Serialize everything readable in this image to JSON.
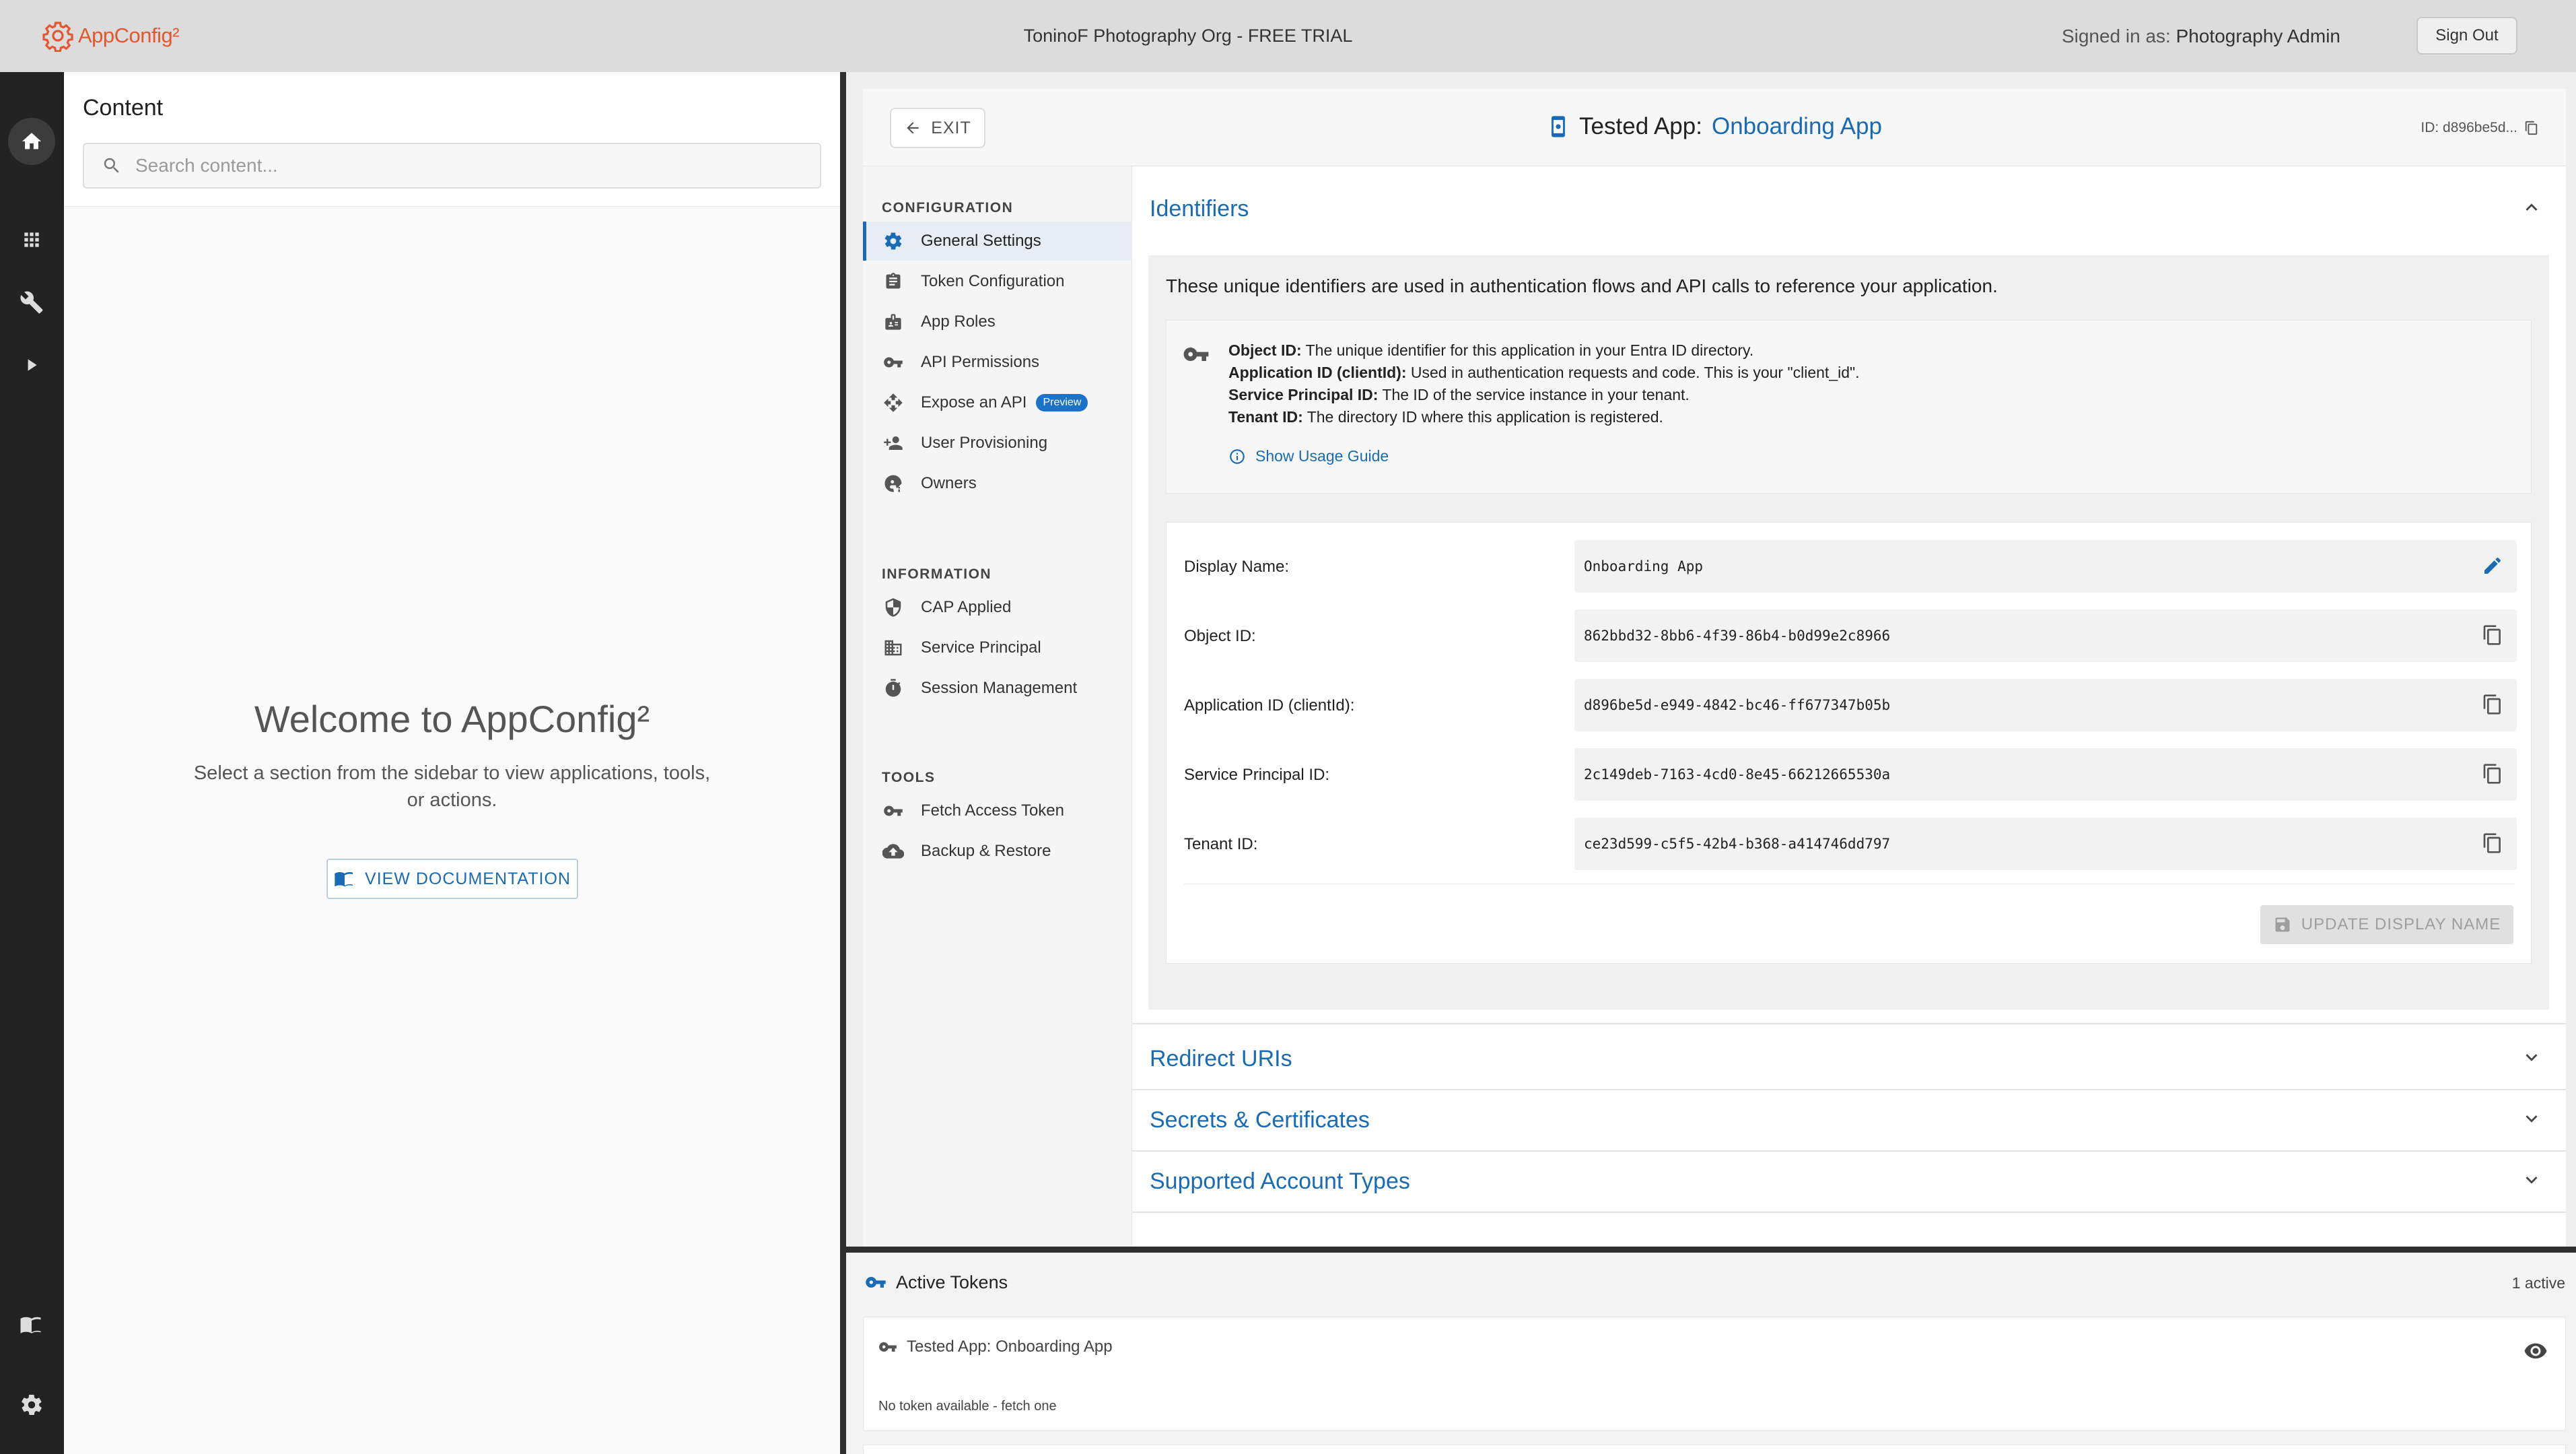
{
  "topbar": {
    "logo_text": "AppConfig²",
    "org_title": "ToninoF Photography Org - FREE TRIAL",
    "signed_in_prefix": "Signed in as:",
    "signed_in_user": "Photography Admin",
    "sign_out_label": "Sign Out"
  },
  "rail": {
    "items": [
      "home-icon",
      "apps-grid-icon",
      "wrench-icon",
      "play-icon",
      "book-icon",
      "gear-icon"
    ]
  },
  "content": {
    "title": "Content",
    "search_placeholder": "Search content...",
    "welcome_title": "Welcome to AppConfig²",
    "welcome_text": "Select a section from the sidebar to view applications, tools, or actions.",
    "doc_button": "VIEW DOCUMENTATION"
  },
  "app": {
    "exit_label": "EXIT",
    "title_prefix": "Tested App:",
    "title_name": "Onboarding App",
    "id_label": "ID: d896be5d..."
  },
  "nav": {
    "sections": [
      {
        "title": "CONFIGURATION",
        "items": [
          {
            "label": "General Settings",
            "icon": "gear-icon",
            "active": true
          },
          {
            "label": "Token Configuration",
            "icon": "clipboard-icon"
          },
          {
            "label": "App Roles",
            "icon": "badge-icon"
          },
          {
            "label": "API Permissions",
            "icon": "key-icon"
          },
          {
            "label": "Expose an API",
            "icon": "move-icon",
            "badge": "Preview"
          },
          {
            "label": "User Provisioning",
            "icon": "person-add-icon"
          },
          {
            "label": "Owners",
            "icon": "owner-icon"
          }
        ]
      },
      {
        "title": "INFORMATION",
        "items": [
          {
            "label": "CAP Applied",
            "icon": "shield-icon"
          },
          {
            "label": "Service Principal",
            "icon": "building-icon"
          },
          {
            "label": "Session Management",
            "icon": "timer-icon"
          }
        ]
      },
      {
        "title": "TOOLS",
        "items": [
          {
            "label": "Fetch Access Token",
            "icon": "key-icon"
          },
          {
            "label": "Backup & Restore",
            "icon": "cloud-upload-icon"
          }
        ]
      }
    ]
  },
  "identifiers": {
    "title": "Identifiers",
    "intro": "These unique identifiers are used in authentication flows and API calls to reference your application.",
    "info_lines": [
      {
        "term": "Object ID:",
        "desc": " The unique identifier for this application in your Entra ID directory."
      },
      {
        "term": "Application ID (clientId):",
        "desc": " Used in authentication requests and code. This is your \"client_id\"."
      },
      {
        "term": "Service Principal ID:",
        "desc": " The ID of the service instance in your tenant."
      },
      {
        "term": "Tenant ID:",
        "desc": " The directory ID where this application is registered."
      }
    ],
    "usage_guide": "Show Usage Guide",
    "fields": [
      {
        "label": "Display Name:",
        "value": "Onboarding App",
        "action": "edit-icon"
      },
      {
        "label": "Object ID:",
        "value": "862bbd32-8bb6-4f39-86b4-b0d99e2c8966",
        "action": "copy-icon"
      },
      {
        "label": "Application ID (clientId):",
        "value": "d896be5d-e949-4842-bc46-ff677347b05b",
        "action": "copy-icon"
      },
      {
        "label": "Service Principal ID:",
        "value": "2c149deb-7163-4cd0-8e45-66212665530a",
        "action": "copy-icon"
      },
      {
        "label": "Tenant ID:",
        "value": "ce23d599-c5f5-42b4-b368-a414746dd797",
        "action": "copy-icon"
      }
    ],
    "update_button": "UPDATE DISPLAY NAME"
  },
  "accordions": [
    "Redirect URIs",
    "Secrets & Certificates",
    "Supported Account Types"
  ],
  "tokens": {
    "title": "Active Tokens",
    "count": "1 active",
    "items": [
      {
        "name": "Tested App: Onboarding App",
        "status": "No token available - fetch one"
      }
    ]
  },
  "colors": {
    "accent": "#1a6bb5",
    "brand": "#e4572e",
    "rail": "#232323",
    "badge": "#1a73c9"
  }
}
